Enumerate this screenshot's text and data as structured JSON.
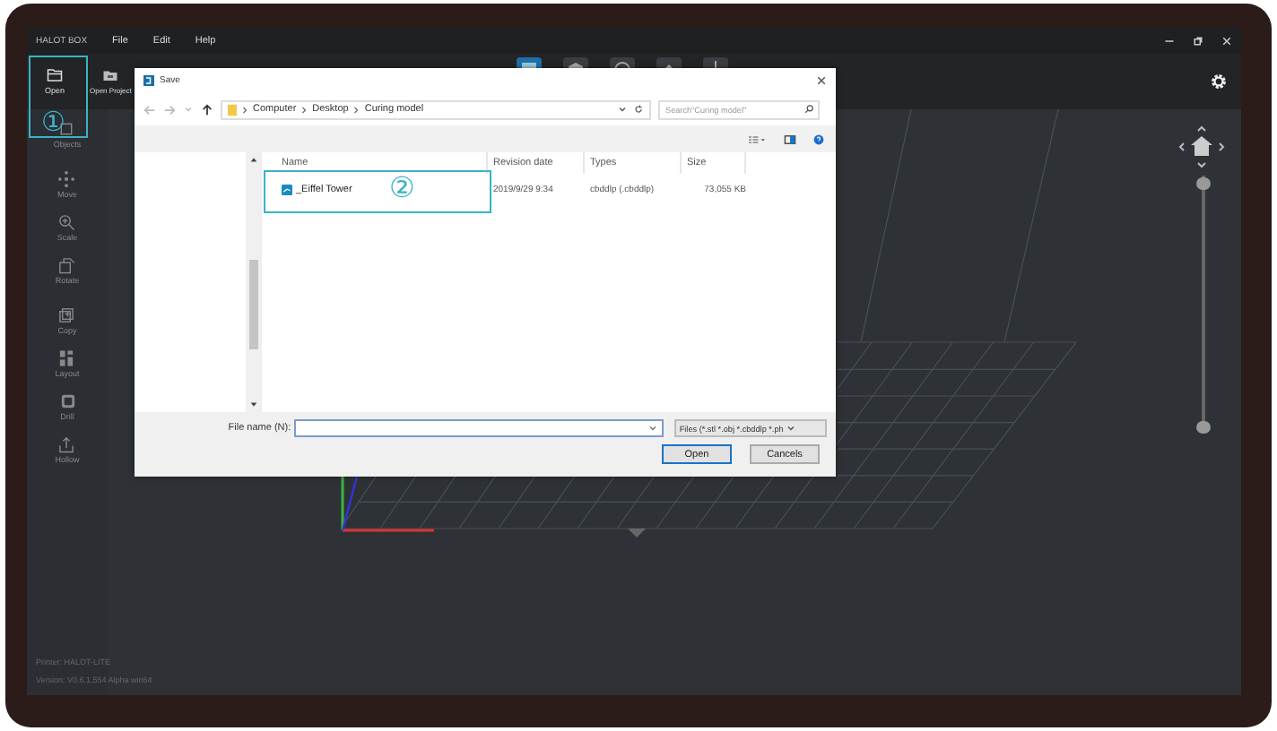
{
  "app": {
    "title": "HALOT BOX",
    "menu": [
      {
        "label": "File"
      },
      {
        "label": "Edit"
      },
      {
        "label": "Help"
      }
    ]
  },
  "toolbar": [
    {
      "label": "Open",
      "kind": "open"
    },
    {
      "label": "Open Project",
      "kind": "project"
    }
  ],
  "sidebar": [
    {
      "label": "Objects",
      "kind": "objects"
    },
    {
      "label": "Move",
      "kind": "move"
    },
    {
      "label": "Scale",
      "kind": "scale"
    },
    {
      "label": "Rotate",
      "kind": "rotate"
    },
    {
      "label": "Copy",
      "kind": "copy"
    },
    {
      "label": "Layout",
      "kind": "layout"
    },
    {
      "label": "Drill",
      "kind": "drill"
    },
    {
      "label": "Hollow",
      "kind": "hollow"
    }
  ],
  "status": [
    "Printer: HALOT-LITE",
    "Version: V0.6.1.554 Alpha win64"
  ],
  "dialog": {
    "title": "Save",
    "breadcrumb": [
      "Computer",
      "Desktop",
      "Curing model"
    ],
    "search": {
      "placeholder": "Search\"Curing model\""
    },
    "columns": [
      "Name",
      "Revision date",
      "Types",
      "Size"
    ],
    "files": [
      {
        "name": "_Eiffel Tower",
        "date": "2019/9/29 9:34",
        "type": "cbddlp (.cbddlp)",
        "size": "73,055 KB"
      }
    ],
    "file_name_label": "File name (N):",
    "file_type": "Files (*.stl *.obj *.cbddlp *.ph",
    "buttons": [
      {
        "label": "Open",
        "primary": true
      },
      {
        "label": "Cancels",
        "primary": false
      }
    ]
  },
  "layer_slider": {
    "upper": {
      "level": 1
    },
    "lower": {
      "level": 0
    }
  },
  "annotations": [
    "①",
    "②"
  ]
}
